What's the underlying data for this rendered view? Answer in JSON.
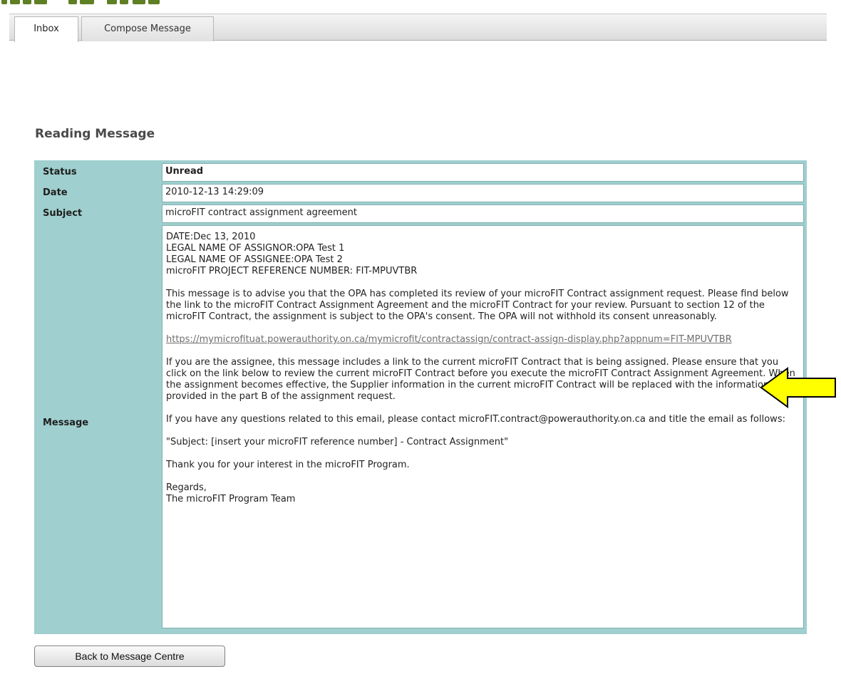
{
  "tabs": [
    {
      "label": "Inbox",
      "active": true
    },
    {
      "label": "Compose Message",
      "active": false
    }
  ],
  "page_title": "Reading Message",
  "message": {
    "status_label": "Status",
    "status_value": "Unread",
    "date_label": "Date",
    "date_value": "2010-12-13 14:29:09",
    "subject_label": "Subject",
    "subject_value": "microFIT contract assignment agreement",
    "message_label": "Message",
    "body": {
      "header_lines": [
        "DATE:Dec 13, 2010",
        "LEGAL NAME OF ASSIGNOR:OPA Test 1",
        "LEGAL NAME OF ASSIGNEE:OPA Test 2",
        "microFIT PROJECT REFERENCE NUMBER: FIT-MPUVTBR"
      ],
      "paragraph1": "This message is to advise you that the OPA has completed its review of your microFIT Contract assignment request. Please find below the link to the microFIT Contract Assignment Agreement and the microFIT Contract for your review. Pursuant to section 12 of the microFIT Contract, the assignment is subject to the OPA's consent. The OPA will not withhold its consent unreasonably.",
      "link": "https://mymicrofituat.powerauthority.on.ca/mymicrofit/contractassign/contract-assign-display.php?appnum=FIT-MPUVTBR",
      "paragraph2": "If you are the assignee, this message includes a link to the current microFIT Contract that is being assigned. Please ensure that you click on the link below to review the current microFIT Contract before you execute the microFIT Contract Assignment Agreement. When the assignment becomes effective, the Supplier information in the current microFIT Contract will be replaced with the information you provided in the part B of the assignment request.",
      "paragraph3": "If you have any questions related to this email, please contact microFIT.contract@powerauthority.on.ca and title the email as follows:",
      "paragraph4": "\"Subject: [insert your microFIT reference number] - Contract Assignment\"",
      "paragraph5": "Thank you for your interest in the microFIT Program.",
      "closing_line1": "Regards,",
      "closing_line2": "The microFIT Program Team"
    }
  },
  "back_button_label": "Back to Message Centre",
  "colors": {
    "table_background": "#9fcfce",
    "cell_border": "#7fb0ae",
    "arrow_fill": "#ffff00",
    "link_color": "#6e6e6e"
  },
  "icons": {
    "arrow": "yellow-left-arrow-icon"
  }
}
